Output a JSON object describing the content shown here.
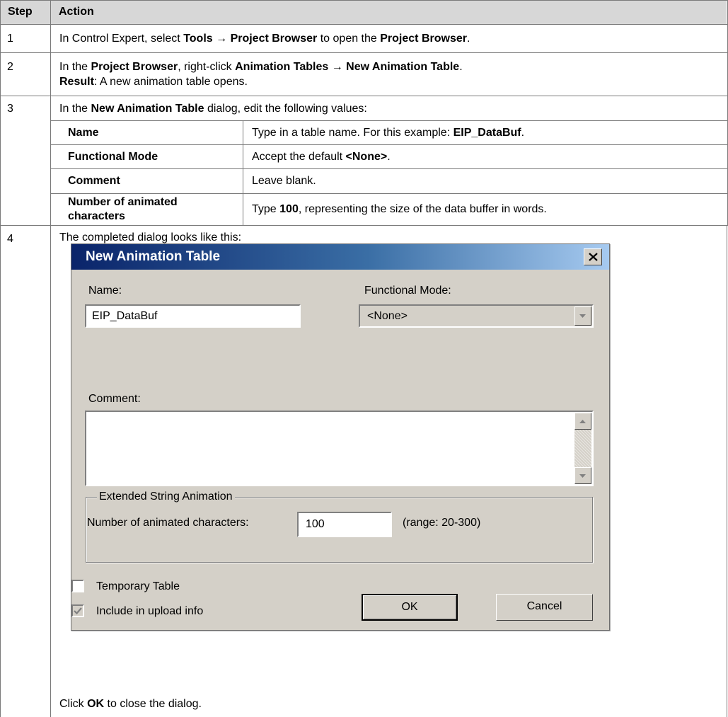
{
  "table": {
    "headers": {
      "step": "Step",
      "action": "Action"
    },
    "rows": [
      {
        "step": "1",
        "parts": [
          "In Control Expert, select ",
          "Tools",
          " → ",
          "Project Browser",
          " to open the ",
          "Project Browser",
          "."
        ]
      },
      {
        "step": "2",
        "line1": [
          "In the ",
          "Project Browser",
          ", right-click ",
          "Animation Tables",
          " → ",
          "New Animation Table",
          "."
        ],
        "line2": [
          "Result",
          ": A new animation table opens."
        ]
      },
      {
        "step": "3",
        "intro": [
          "In the ",
          "New Animation Table",
          " dialog, edit the following values:"
        ],
        "subtable": [
          {
            "field": "Name",
            "desc": [
              "Type in a table name. For this example: ",
              "EIP_DataBuf",
              "."
            ]
          },
          {
            "field": "Functional Mode",
            "desc": [
              "Accept the default ",
              "<None>",
              "."
            ]
          },
          {
            "field": "Comment",
            "desc": [
              "Leave blank."
            ]
          },
          {
            "field_line1": "Number of animated",
            "field_line2": "characters",
            "desc": [
              "Type ",
              "100",
              ", representing the size of the data buffer in words."
            ]
          }
        ]
      },
      {
        "step": "4",
        "intro": "The completed dialog looks like this:",
        "outro": [
          "Click ",
          "OK",
          " to close the dialog."
        ]
      }
    ]
  },
  "dialog": {
    "title": "New Animation Table",
    "name_label": "Name:",
    "name_value": "EIP_DataBuf",
    "functional_mode_label": "Functional Mode:",
    "functional_mode_value": "<None>",
    "comment_label": "Comment:",
    "comment_value": "",
    "group_label": "Extended String Animation",
    "chars_label": "Number of animated characters:",
    "chars_value": "100",
    "range_text": "(range: 20-300)",
    "temporary_label": "Temporary Table",
    "temporary_checked": false,
    "upload_label": "Include in upload info",
    "upload_checked": true,
    "ok_label": "OK",
    "cancel_label": "Cancel"
  },
  "icons": [
    "close-icon",
    "dropdown-arrow-icon",
    "scroll-up-icon",
    "scroll-down-icon",
    "checkmark-icon"
  ],
  "colors": {
    "header_bg": "#d7d7d7",
    "grid_line": "#7a7a7a",
    "title_start": "#0a246a",
    "title_end": "#a6caf0",
    "dialog_bg": "#d4d0c8"
  }
}
